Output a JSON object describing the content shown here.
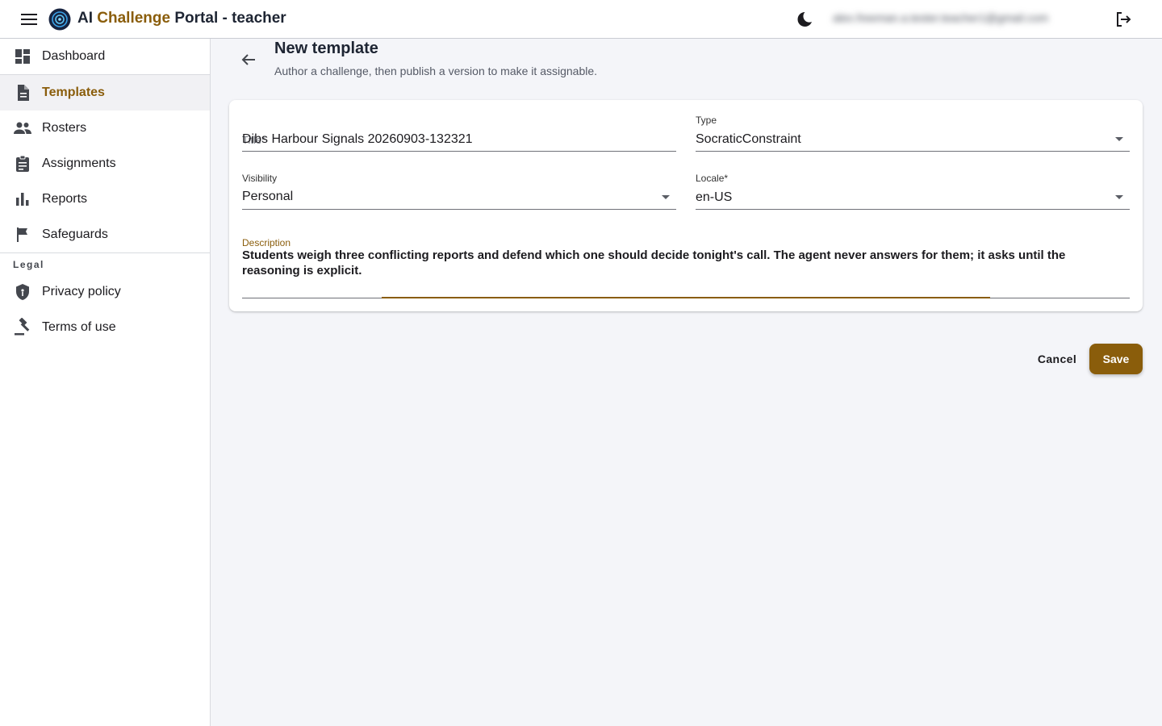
{
  "app": {
    "title_prefix": "AI ",
    "title_accent": "Challenge",
    "title_suffix": " Portal - teacher",
    "user_email": "alex.freeman.a.tester.teacher1@gmail.com"
  },
  "sidebar": {
    "items": [
      {
        "label": "Dashboard",
        "icon": "dashboard-icon"
      },
      {
        "label": "Templates",
        "icon": "document-icon",
        "active": true
      },
      {
        "label": "Rosters",
        "icon": "people-icon"
      },
      {
        "label": "Assignments",
        "icon": "clipboard-icon"
      },
      {
        "label": "Reports",
        "icon": "bar-chart-icon"
      },
      {
        "label": "Safeguards",
        "icon": "flag-icon"
      }
    ],
    "legal_heading": "Legal",
    "legal_items": [
      {
        "label": "Privacy policy",
        "icon": "shield-icon"
      },
      {
        "label": "Terms of use",
        "icon": "gavel-icon"
      }
    ]
  },
  "page": {
    "title": "New template",
    "subtitle": "Author a challenge, then publish a version to make it assignable."
  },
  "form": {
    "title_label": "Title*",
    "title_value": "Dibs Harbour Signals 20260903-132321",
    "type_label": "Type",
    "type_value": "SocraticConstraint",
    "visibility_label": "Visibility",
    "visibility_value": "Personal",
    "locale_label": "Locale*",
    "locale_value": "en-US",
    "description_label": "Description",
    "description_value": "Students weigh three conflicting reports and defend which one should decide tonight's call. The agent never answers for them; it asks until the reasoning is explicit."
  },
  "actions": {
    "cancel_label": "Cancel",
    "save_label": "Save"
  },
  "colors": {
    "accent": "#8a5d0b",
    "background": "#f4f5f9",
    "text": "#1c1b1f"
  }
}
